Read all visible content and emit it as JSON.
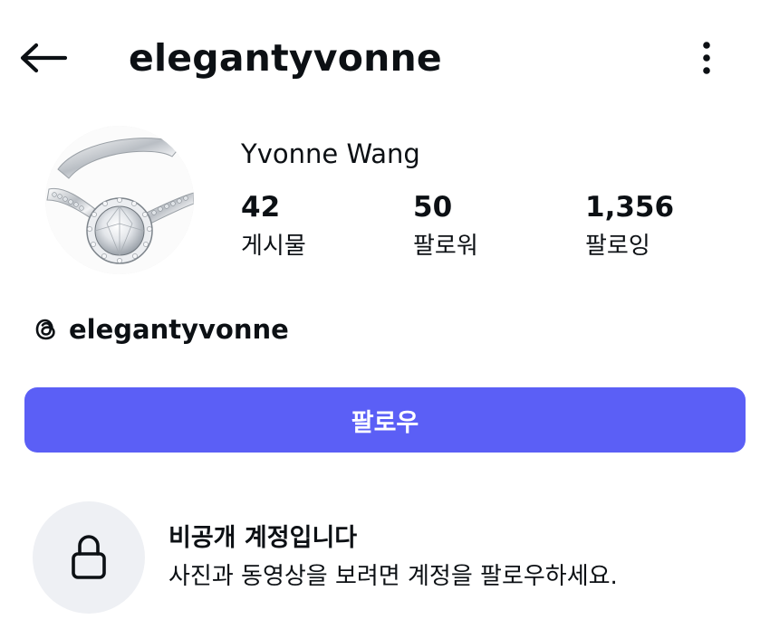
{
  "header": {
    "username": "elegantyvonne",
    "back_icon": "arrow-left-icon",
    "more_icon": "more-vertical-icon"
  },
  "profile": {
    "display_name": "Yvonne Wang",
    "avatar": "ring-photo",
    "stats": [
      {
        "value": "42",
        "label": "게시물"
      },
      {
        "value": "50",
        "label": "팔로워"
      },
      {
        "value": "1,356",
        "label": "팔로잉"
      }
    ],
    "threads": {
      "icon": "threads-icon",
      "handle": "elegantyvonne"
    }
  },
  "follow_button": {
    "label": "팔로우",
    "color": "#5b5ff6"
  },
  "private_notice": {
    "icon": "lock-icon",
    "title": "비공개 계정입니다",
    "description": "사진과 동영상을 보려면 계정을 팔로우하세요."
  }
}
